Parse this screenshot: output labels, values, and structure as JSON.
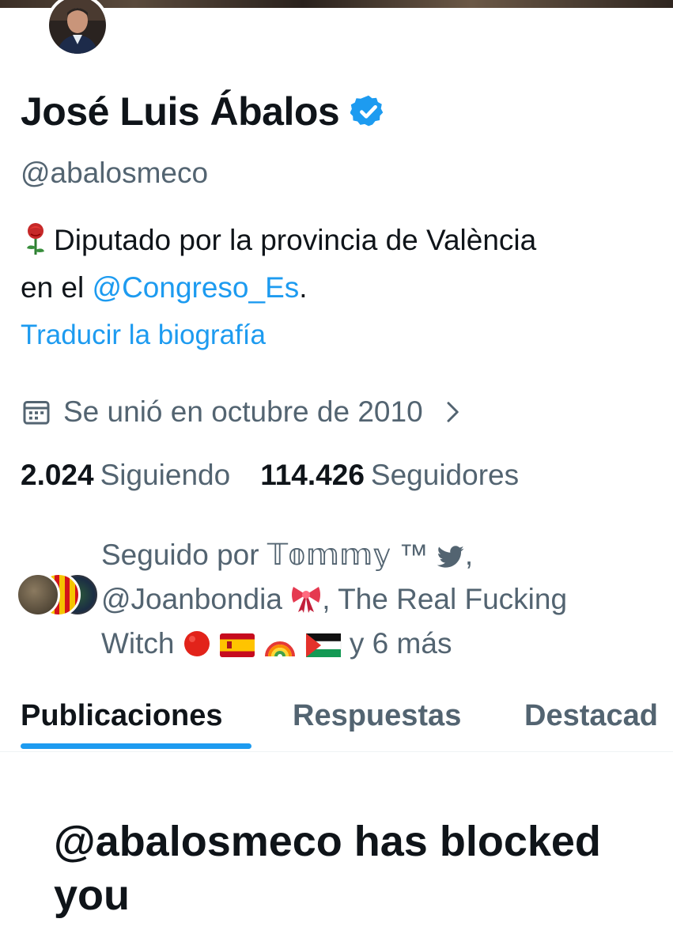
{
  "profile": {
    "name": "José Luis Ábalos",
    "handle": "@abalosmeco",
    "bio_line1": "Diputado por la provincia de València",
    "bio_line2_prefix": "en el ",
    "bio_mention": "@Congreso_Es",
    "bio_line2_suffix": ".",
    "translate_link": "Traducir la biografía",
    "joined": "Se unió en octubre de 2010",
    "following_count": "2.024",
    "following_label": "Siguiendo",
    "followers_count": "114.426",
    "followers_label": "Seguidores"
  },
  "followed_by": {
    "prefix": "Seguido por ",
    "user1": "𝕋𝕠𝕞𝕞𝕪 ™",
    "user2": "@Joanbondia",
    "user3": ", The Real Fucking Witch",
    "suffix": " y 6 más"
  },
  "tabs": [
    {
      "label": "Publicaciones",
      "active": true
    },
    {
      "label": "Respuestas",
      "active": false
    },
    {
      "label": "Destacad",
      "active": false
    }
  ],
  "blocked_message": "@abalosmeco has blocked you",
  "colors": {
    "accent": "#1d9bf0",
    "text_primary": "#0f1419",
    "text_secondary": "#536471"
  },
  "icons": {
    "verified": "verified-badge-icon",
    "calendar": "calendar-icon",
    "chevron": "chevron-right-icon"
  }
}
